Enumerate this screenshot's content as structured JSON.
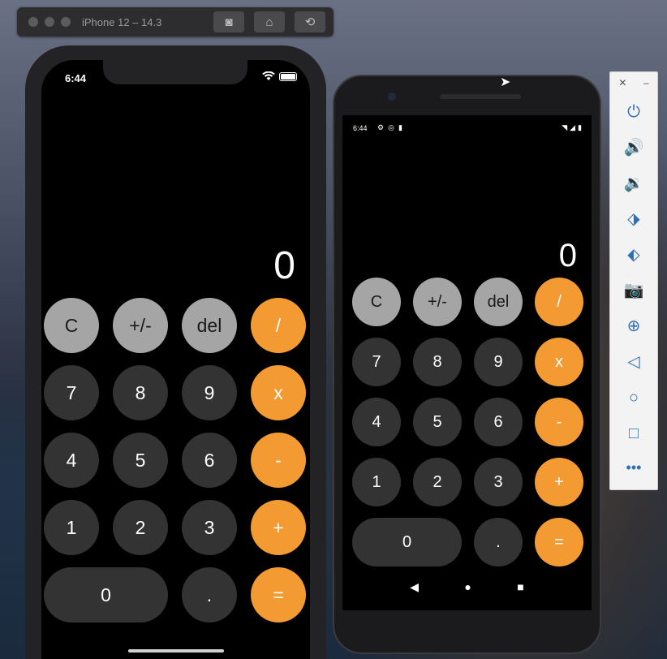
{
  "simulator": {
    "title": "iPhone 12 – 14.3",
    "tools": [
      "screenshot-icon",
      "home-icon",
      "rotate-icon"
    ]
  },
  "ios": {
    "time": "6:44",
    "display": "0",
    "buttons": [
      {
        "label": "C",
        "kind": "gray"
      },
      {
        "label": "+/-",
        "kind": "gray"
      },
      {
        "label": "del",
        "kind": "gray"
      },
      {
        "label": "/",
        "kind": "orange"
      },
      {
        "label": "7",
        "kind": "dark"
      },
      {
        "label": "8",
        "kind": "dark"
      },
      {
        "label": "9",
        "kind": "dark"
      },
      {
        "label": "x",
        "kind": "orange"
      },
      {
        "label": "4",
        "kind": "dark"
      },
      {
        "label": "5",
        "kind": "dark"
      },
      {
        "label": "6",
        "kind": "dark"
      },
      {
        "label": "-",
        "kind": "orange"
      },
      {
        "label": "1",
        "kind": "dark"
      },
      {
        "label": "2",
        "kind": "dark"
      },
      {
        "label": "3",
        "kind": "dark"
      },
      {
        "label": "+",
        "kind": "orange"
      },
      {
        "label": "0",
        "kind": "dark",
        "wide": true
      },
      {
        "label": ".",
        "kind": "dark"
      },
      {
        "label": "=",
        "kind": "orange"
      }
    ]
  },
  "android": {
    "time": "6:44",
    "display": "0",
    "buttons": [
      {
        "label": "C",
        "kind": "gray"
      },
      {
        "label": "+/-",
        "kind": "gray"
      },
      {
        "label": "del",
        "kind": "gray"
      },
      {
        "label": "/",
        "kind": "orange"
      },
      {
        "label": "7",
        "kind": "dark"
      },
      {
        "label": "8",
        "kind": "dark"
      },
      {
        "label": "9",
        "kind": "dark"
      },
      {
        "label": "x",
        "kind": "orange"
      },
      {
        "label": "4",
        "kind": "dark"
      },
      {
        "label": "5",
        "kind": "dark"
      },
      {
        "label": "6",
        "kind": "dark"
      },
      {
        "label": "-",
        "kind": "orange"
      },
      {
        "label": "1",
        "kind": "dark"
      },
      {
        "label": "2",
        "kind": "dark"
      },
      {
        "label": "3",
        "kind": "dark"
      },
      {
        "label": "+",
        "kind": "orange"
      },
      {
        "label": "0",
        "kind": "dark",
        "wide": true
      },
      {
        "label": ".",
        "kind": "dark"
      },
      {
        "label": "=",
        "kind": "orange"
      }
    ],
    "nav": [
      "back-icon",
      "home-icon",
      "recents-icon"
    ]
  },
  "emulator_panel": {
    "tools": [
      "power-icon",
      "volume-up-icon",
      "volume-down-icon",
      "rotate-left-icon",
      "rotate-right-icon",
      "camera-icon",
      "zoom-icon",
      "back-icon",
      "home-icon",
      "overview-icon",
      "more-icon"
    ]
  },
  "colors": {
    "gray": "#a5a5a5",
    "dark": "#333333",
    "orange": "#f39a32"
  }
}
